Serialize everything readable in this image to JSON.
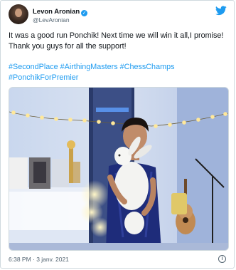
{
  "tweet": {
    "author": {
      "display_name": "Levon Aronian",
      "handle": "@LevAronian",
      "verified": true
    },
    "text": "It was a good run Ponchik! Next time we will win it all,I promise! Thank you guys for all the support!",
    "hashtags": [
      "#SecondPlace",
      "#AirthingMasters",
      "#ChessChamps",
      "#PonchikForPremier"
    ],
    "timestamp": "6:38 PM · 3 janv. 2021",
    "media_alt": "man holding a white rabbit in a room with string lights"
  },
  "icons": {
    "bird": "twitter-bird-icon",
    "info": "info-icon",
    "verified": "verified-badge-icon"
  },
  "colors": {
    "link": "#1d9bf0",
    "text": "#0f1419",
    "muted": "#536471",
    "border": "#cfd9de"
  }
}
